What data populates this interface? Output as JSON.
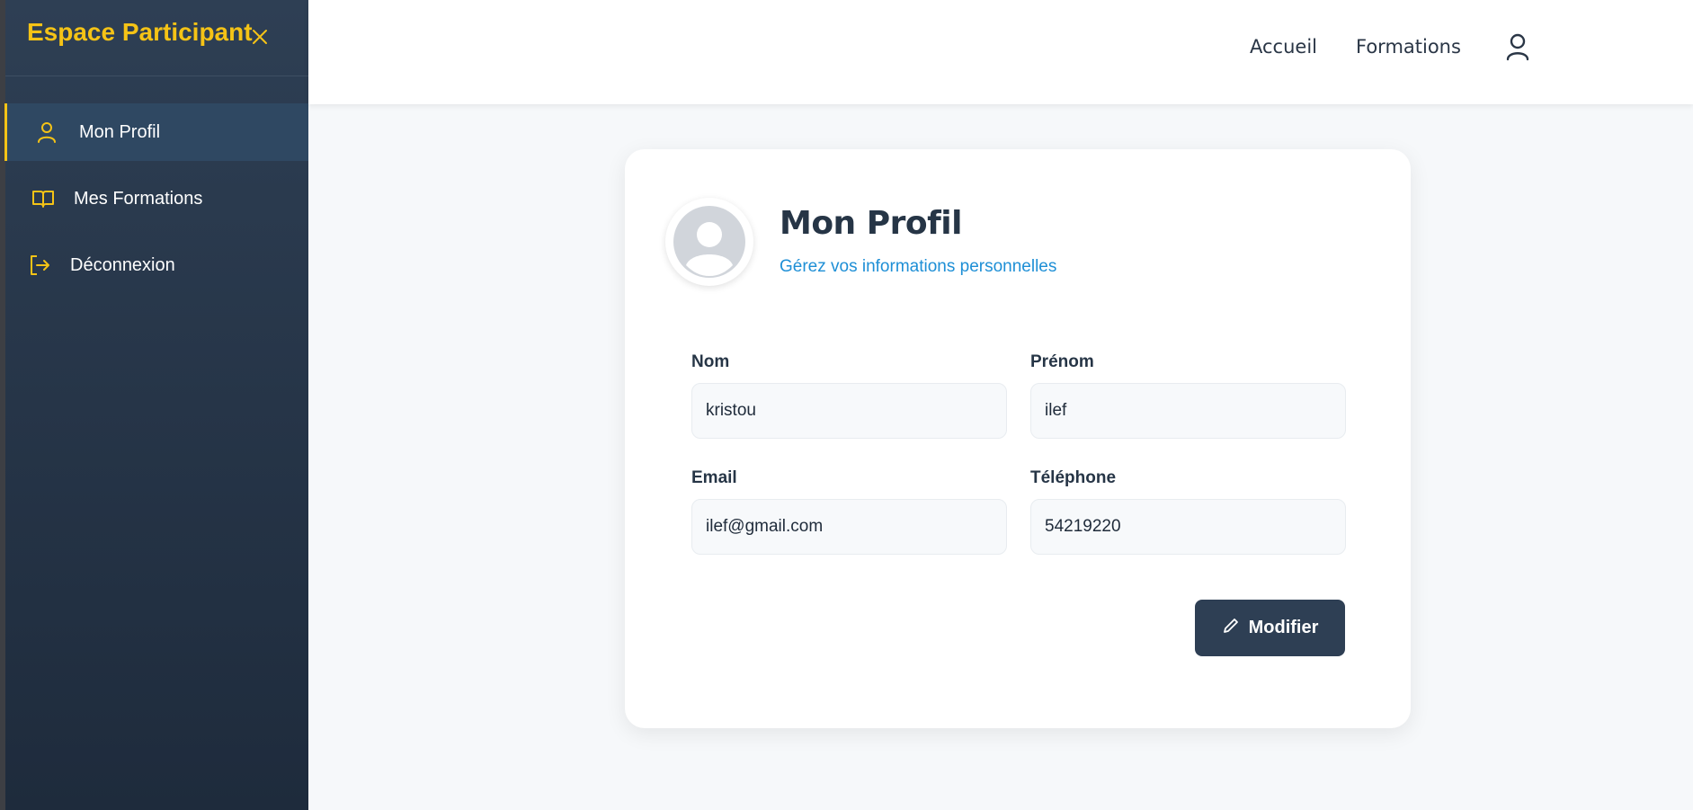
{
  "sidebar": {
    "title": "Espace Participant",
    "accent_color": "#f5c316",
    "items": [
      {
        "label": "Mon Profil",
        "icon": "user-icon",
        "active": true
      },
      {
        "label": "Mes Formations",
        "icon": "book-icon",
        "active": false
      },
      {
        "label": "Déconnexion",
        "icon": "logout-icon",
        "active": false
      }
    ]
  },
  "topbar": {
    "links": [
      "Accueil",
      "Formations"
    ],
    "user_icon": "user-icon"
  },
  "profile": {
    "title": "Mon Profil",
    "subtitle": "Gérez vos informations personnelles",
    "fields": {
      "nom": {
        "label": "Nom",
        "value": "kristou"
      },
      "prenom": {
        "label": "Prénom",
        "value": "ilef"
      },
      "email": {
        "label": "Email",
        "value": "ilef@gmail.com"
      },
      "telephone": {
        "label": "Téléphone",
        "value": "54219220"
      }
    },
    "modify_button": "Modifier"
  }
}
